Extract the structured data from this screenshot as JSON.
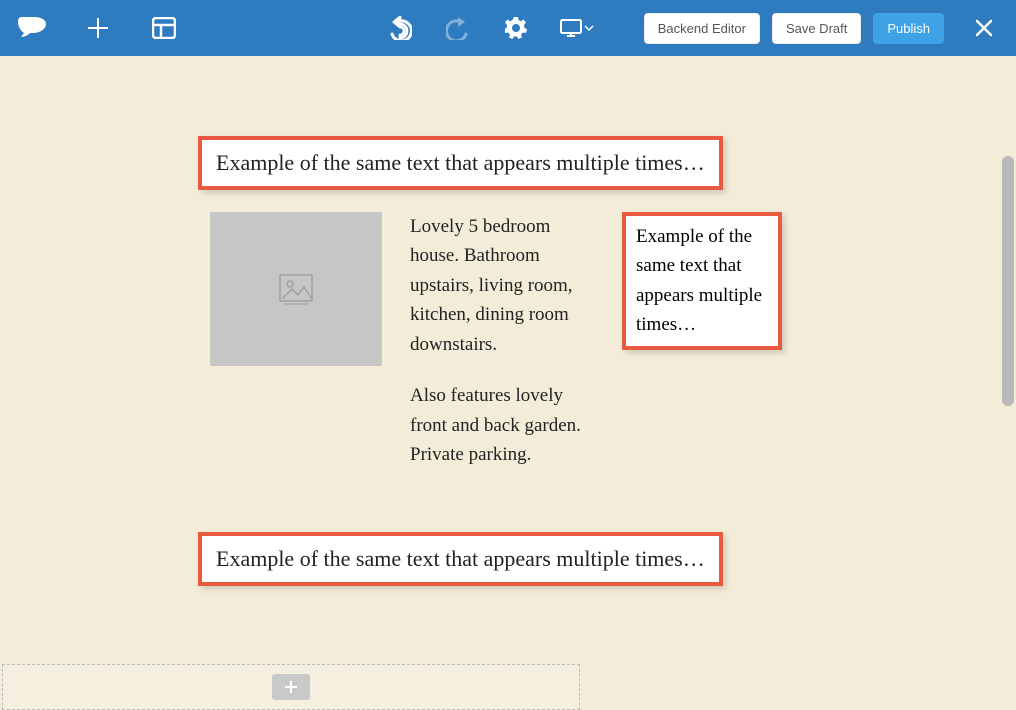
{
  "toolbar": {
    "backend_editor": "Backend Editor",
    "save_draft": "Save Draft",
    "publish": "Publish"
  },
  "content": {
    "heading_top": "Example of the same text that appears multiple times…",
    "body_para1": "Lovely 5 bedroom house. Bathroom upstairs, living room, kitchen, dining room downstairs.",
    "body_para2": "Also features lovely front and back garden. Private parking.",
    "side_text": "Example of the same text that appears multiple times…",
    "heading_bottom": "Example of the same text that appears multiple times…"
  }
}
